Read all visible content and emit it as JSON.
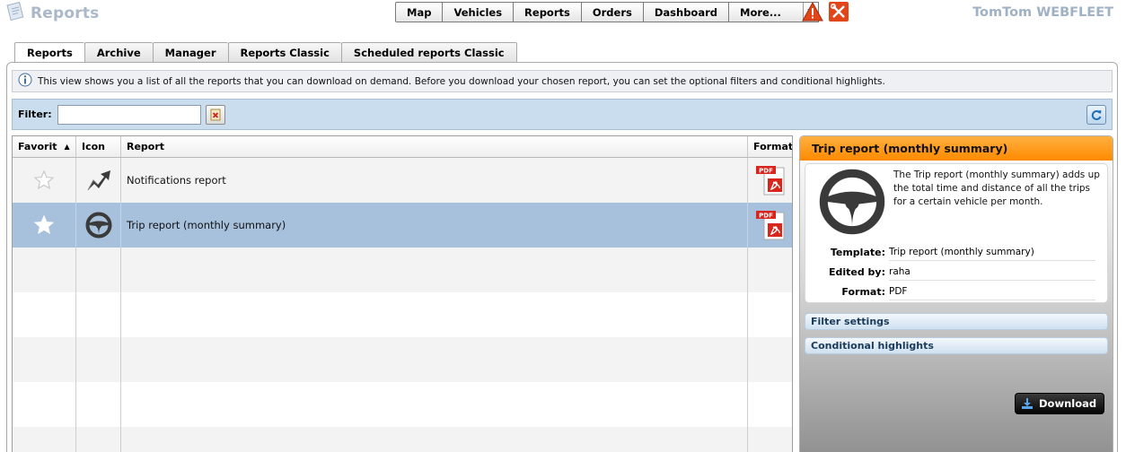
{
  "app": {
    "title": "Reports",
    "brand": "TomTom WEBFLEET",
    "icon": "reports-doc-icon"
  },
  "nav": {
    "items": [
      {
        "label": "Map"
      },
      {
        "label": "Vehicles"
      },
      {
        "label": "Reports"
      },
      {
        "label": "Orders"
      },
      {
        "label": "Dashboard"
      }
    ],
    "more_label": "More...",
    "icons": [
      "warning-icon",
      "tools-icon"
    ]
  },
  "tabs": [
    {
      "label": "Reports",
      "active": true
    },
    {
      "label": "Archive",
      "active": false
    },
    {
      "label": "Manager",
      "active": false
    },
    {
      "label": "Reports Classic",
      "active": false
    },
    {
      "label": "Scheduled reports Classic",
      "active": false
    }
  ],
  "info": {
    "text": "This view shows you a list of all the reports that you can download on demand. Before you download your chosen report, you can set the optional filters and conditional highlights."
  },
  "filter": {
    "label": "Filter:",
    "value": "",
    "placeholder": ""
  },
  "table": {
    "columns": {
      "favorite": "Favorit",
      "icon": "Icon",
      "report": "Report",
      "format": "Format"
    },
    "sort_indicator": "▲",
    "rows": [
      {
        "name": "Notifications report",
        "favorite": false,
        "icon": "notification-arrow-icon",
        "format": "PDF",
        "selected": false
      },
      {
        "name": "Trip report (monthly summary)",
        "favorite": true,
        "icon": "steering-wheel-icon",
        "format": "PDF",
        "selected": true
      }
    ]
  },
  "detail": {
    "title": "Trip report (monthly summary)",
    "description": "The Trip report (monthly summary) adds up the total time and distance of all the trips for a certain vehicle per month.",
    "fields": {
      "template_label": "Template:",
      "template_value": "Trip report (monthly summary)",
      "edited_label": "Edited by:",
      "edited_value": "raha",
      "format_label": "Format:",
      "format_value": "PDF"
    },
    "sections": {
      "filter_settings": "Filter settings",
      "conditional_highlights": "Conditional highlights"
    },
    "download_label": "Download"
  },
  "colors": {
    "accent_orange": "#ff8a00",
    "selection_blue": "#a7c1dd",
    "filterbar_blue": "#c9ddef",
    "brand_gray_blue": "#9fb1c4"
  }
}
